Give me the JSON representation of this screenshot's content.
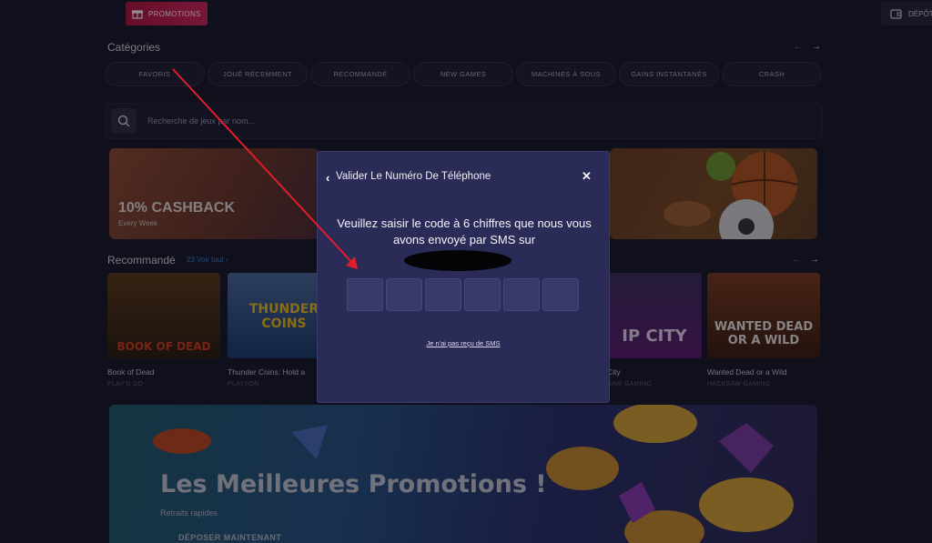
{
  "topbar": {
    "promo_label": "PROMOTIONS",
    "depot_label": "DÉPÔT"
  },
  "categories": {
    "title": "Catégories",
    "items": [
      {
        "label": "FAVORIS",
        "width": 110
      },
      {
        "label": "JOUÉ RÉCEMMENT",
        "width": 110
      },
      {
        "label": "RECOMMANDÉ",
        "width": 110
      },
      {
        "label": "NEW GAMES",
        "width": 110
      },
      {
        "label": "MACHINES À SOUS",
        "width": 110
      },
      {
        "label": "GAINS INSTANTANÉS",
        "width": 110
      },
      {
        "label": "CRASH",
        "width": 110
      }
    ],
    "prev": "←",
    "next": "→"
  },
  "search": {
    "placeholder": "Recherche de jeux par nom..."
  },
  "banner": {
    "title": "10% CASHBACK",
    "subtitle": "Every Week"
  },
  "recommended": {
    "title": "Recommandé",
    "link": "23 Voir tout",
    "games": [
      {
        "name": "Book of Dead",
        "provider": "PLAY'N GO",
        "art": "BOOK OF DEAD"
      },
      {
        "name": "Thunder Coins: Hold a",
        "provider": "PLAYSON",
        "art": "THUNDER COINS"
      },
      {
        "name": "City",
        "provider": "SAW GAMING",
        "art": "IP CITY"
      },
      {
        "name": "Wanted Dead or a Wild",
        "provider": "HACKSAW GAMING",
        "art": "WANTED DEAD OR A WILD"
      }
    ]
  },
  "promo": {
    "title": "Les Meilleures Promotions !",
    "subtitle": "Retraits rapides",
    "cta": "DÉPOSER MAINTENANT"
  },
  "modal": {
    "title": "Valider Le Numéro De Téléphone",
    "instruction": "Veuillez saisir le code à 6 chiffres que nous vous avons envoyé par SMS sur",
    "code_boxes": [
      "",
      "",
      "",
      "",
      "",
      ""
    ],
    "no_sms": "Je n'ai pas reçu de SMS"
  },
  "colors": {
    "accent": "#d3245a",
    "modal_bg": "#2b2b58",
    "link": "#3b84c7",
    "annotation": "#e11d2a"
  }
}
